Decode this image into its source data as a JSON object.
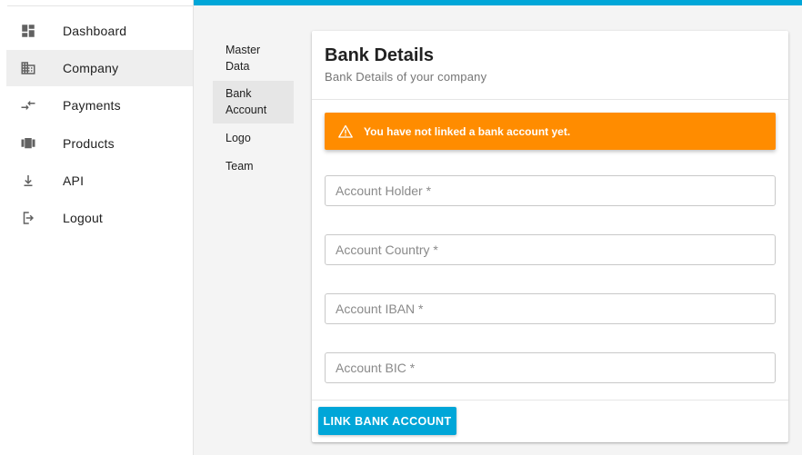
{
  "sidebar": {
    "items": [
      {
        "label": "Dashboard",
        "icon": "dashboard-icon",
        "active": false
      },
      {
        "label": "Company",
        "icon": "company-icon",
        "active": true
      },
      {
        "label": "Payments",
        "icon": "payments-icon",
        "active": false
      },
      {
        "label": "Products",
        "icon": "products-icon",
        "active": false
      },
      {
        "label": "API",
        "icon": "api-icon",
        "active": false
      },
      {
        "label": "Logout",
        "icon": "logout-icon",
        "active": false
      }
    ]
  },
  "subnav": {
    "items": [
      {
        "label": "Master Data",
        "active": false
      },
      {
        "label": "Bank Account",
        "active": true
      },
      {
        "label": "Logo",
        "active": false
      },
      {
        "label": "Team",
        "active": false
      }
    ]
  },
  "card": {
    "title": "Bank Details",
    "subtitle": "Bank Details of your company",
    "alert": {
      "text": "You have not linked a bank account yet.",
      "icon": "warning-icon"
    },
    "fields": [
      {
        "placeholder": "Account Holder *",
        "value": ""
      },
      {
        "placeholder": "Account Country *",
        "value": ""
      },
      {
        "placeholder": "Account IBAN *",
        "value": ""
      },
      {
        "placeholder": "Account BIC *",
        "value": ""
      }
    ],
    "button_label": "LINK BANK ACCOUNT"
  },
  "colors": {
    "accent": "#00a6d8",
    "alert": "#ff8c00",
    "active_nav": "#eeeeee"
  }
}
